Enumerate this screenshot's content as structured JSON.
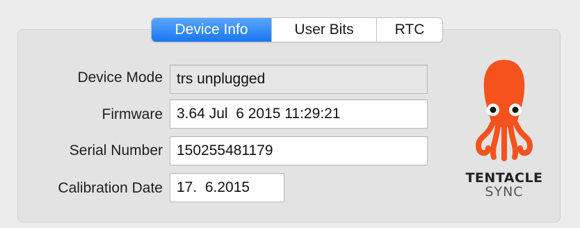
{
  "tabs": {
    "device_info": "Device Info",
    "user_bits": "User Bits",
    "rtc": "RTC"
  },
  "fields": {
    "device_mode": {
      "label": "Device Mode",
      "value": "trs unplugged"
    },
    "firmware": {
      "label": "Firmware",
      "value": "3.64 Jul  6 2015 11:29:21"
    },
    "serial_number": {
      "label": "Serial Number",
      "value": "150255481179"
    },
    "calibration_date": {
      "label": "Calibration Date",
      "value": "17.  6.2015"
    }
  },
  "logo": {
    "brand_line1": "TENTACLE",
    "brand_line2": "SYNC",
    "octopus_color": "#f5521e"
  },
  "colors": {
    "tab_active": "#1a76f2"
  }
}
